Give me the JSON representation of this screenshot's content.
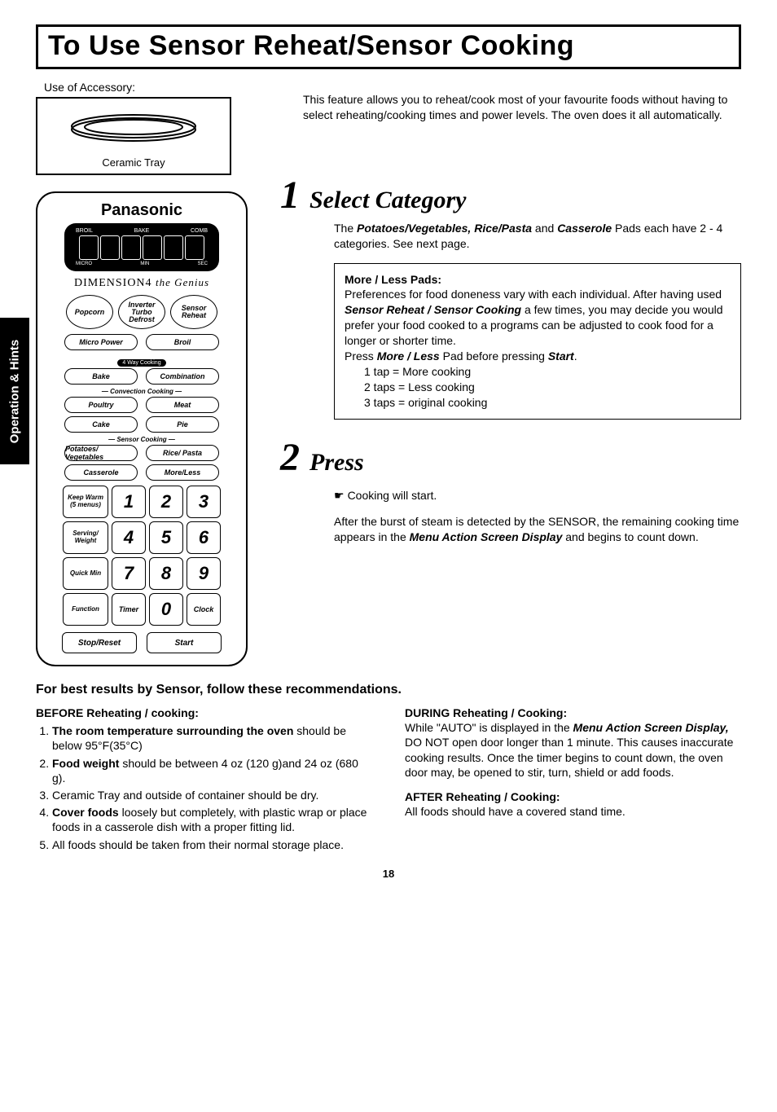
{
  "sideTab": "Operation & Hints",
  "title": "To Use Sensor Reheat/Sensor Cooking",
  "accessory": {
    "label": "Use of Accessory:",
    "tray": "Ceramic Tray"
  },
  "panel": {
    "brand": "Panasonic",
    "dispTop": [
      "BROIL",
      "BAKE",
      "COMB"
    ],
    "dispBot": [
      "MICRO",
      "MIN",
      "SEC"
    ],
    "subbrand": "DIMENSION4",
    "subbrandScript": "the Genius",
    "row3a": [
      "Popcorn",
      "Inverter Turbo Defrost",
      "Sensor Reheat"
    ],
    "row2a": [
      "Micro Power",
      "Broil"
    ],
    "badge": "4 Way Cooking",
    "row2b": [
      "Bake",
      "Combination"
    ],
    "sectConv": "Convection Cooking",
    "row2c": [
      "Poultry",
      "Meat"
    ],
    "row2d": [
      "Cake",
      "Pie"
    ],
    "sectSensor": "Sensor Cooking",
    "row2e": [
      "Potatoes/ Vegetables",
      "Rice/ Pasta"
    ],
    "row2f": [
      "Casserole",
      "More/Less"
    ],
    "keypad": {
      "labels": [
        "Keep Warm (5 menus)",
        "Serving/ Weight",
        "Quick Min",
        "Function"
      ],
      "side4": [
        "Timer",
        "0",
        "Clock"
      ],
      "nums": [
        "1",
        "2",
        "3",
        "4",
        "5",
        "6",
        "7",
        "8",
        "9"
      ]
    },
    "bottom": [
      "Stop/Reset",
      "Start"
    ]
  },
  "intro": "This feature allows you to reheat/cook most of your favourite foods without having to select reheating/cooking times and power levels. The oven does it all automatically.",
  "step1": {
    "num": "1",
    "title": "Select Category",
    "body1a": "The ",
    "body1b": "Potatoes/Vegetables, Rice/Pasta",
    "body1c": " and ",
    "body1d": "Casserole",
    "body1e": " Pads each have 2 - 4 categories. See next page.",
    "box": {
      "head": "More / Less Pads:",
      "p1a": "Preferences for food doneness vary with each individual. After having used ",
      "p1b": "Sensor Reheat / Sensor Cooking",
      "p1c": " a few times, you may decide you would prefer your food cooked to a programs can be adjusted to cook food for a longer or shorter time.",
      "p2a": "Press ",
      "p2b": "More / Less",
      "p2c": " Pad before pressing ",
      "p2d": "Start",
      "p2e": ".",
      "t1": "1 tap  = More cooking",
      "t2": "2 taps = Less cooking",
      "t3": "3 taps = original cooking"
    }
  },
  "step2": {
    "num": "2",
    "title": "Press",
    "body1": "Cooking will start.",
    "body2a": "After the burst of steam is detected by the SENSOR, the remaining cooking time appears in the ",
    "body2b": "Menu Action Screen Display",
    "body2c": " and begins to count down."
  },
  "bottom": {
    "head": "For best results by Sensor, follow these recommendations.",
    "before": {
      "head": "BEFORE Reheating / cooking:",
      "i1a": "The room temperature surrounding the oven",
      "i1b": " should be below 95°F(35°C)",
      "i2a": "Food weight",
      "i2b": " should be between 4 oz (120 g)and 24 oz (680 g).",
      "i3": "Ceramic Tray and outside of container should be dry.",
      "i4a": "Cover foods",
      "i4b": " loosely but completely, with plastic wrap or place foods in a casserole dish with a proper fitting lid.",
      "i5": "All foods should be taken from their normal storage place."
    },
    "during": {
      "head": "DURING Reheating / Cooking:",
      "p1a": "While \"AUTO\" is displayed in the ",
      "p1b": "Menu Action Screen Display,",
      "p1c": " DO NOT open door longer than 1 minute. This causes inaccurate cooking results. Once the timer begins to count down, the oven door may, be opened to stir, turn, shield or add foods."
    },
    "after": {
      "head": "AFTER Reheating / Cooking:",
      "p": "All foods should have a covered stand time."
    }
  },
  "pageNumber": "18"
}
